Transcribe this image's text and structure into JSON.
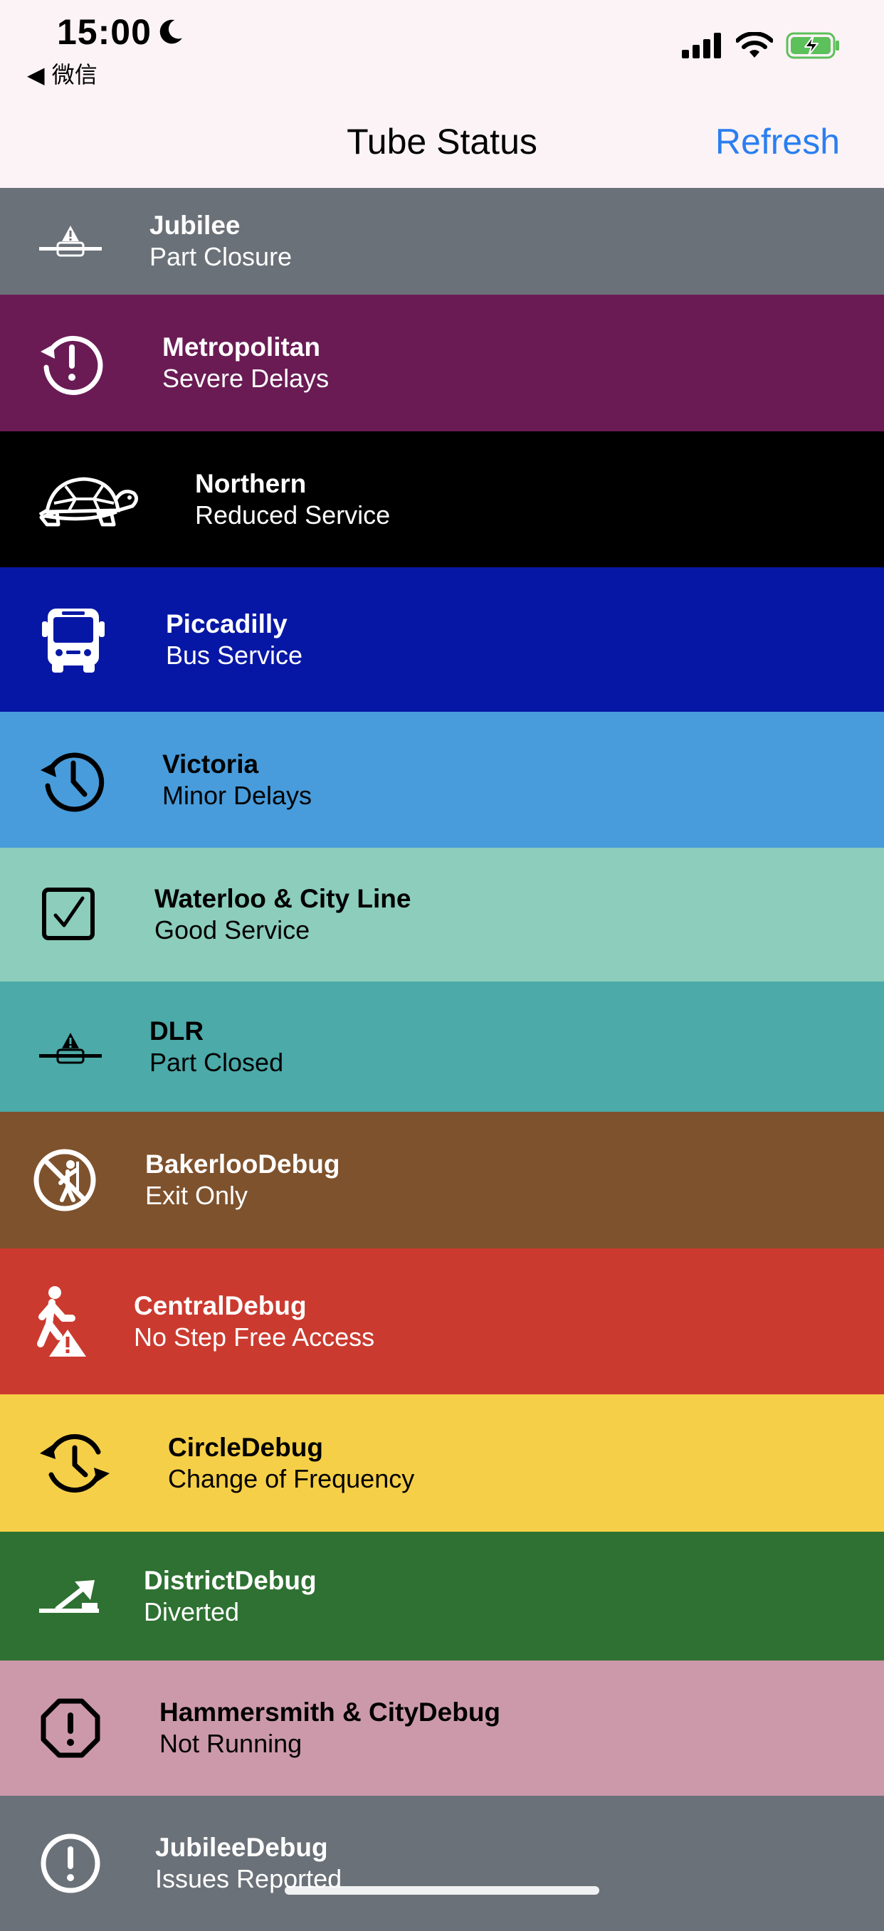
{
  "status_bar": {
    "time": "15:00",
    "back_app": "◀ 微信"
  },
  "nav": {
    "title": "Tube Status",
    "refresh_label": "Refresh"
  },
  "lines": [
    {
      "name": "Jubilee",
      "status": "Part Closure",
      "bg": "#6b7178",
      "fg": "#ffffff",
      "icon": "part-closure-icon"
    },
    {
      "name": "Metropolitan",
      "status": "Severe Delays",
      "bg": "#6a1b54",
      "fg": "#ffffff",
      "icon": "severe-delays-icon"
    },
    {
      "name": "Northern",
      "status": "Reduced Service",
      "bg": "#000000",
      "fg": "#ffffff",
      "icon": "turtle-icon"
    },
    {
      "name": "Piccadilly",
      "status": "Bus Service",
      "bg": "#0717a5",
      "fg": "#ffffff",
      "icon": "bus-icon"
    },
    {
      "name": "Victoria",
      "status": "Minor Delays",
      "bg": "#489cdb",
      "fg": "#000000",
      "icon": "clock-history-icon"
    },
    {
      "name": "Waterloo & City Line",
      "status": "Good Service",
      "bg": "#8ccdbb",
      "fg": "#000000",
      "icon": "checkbox-icon"
    },
    {
      "name": "DLR",
      "status": "Part Closed",
      "bg": "#4caaa9",
      "fg": "#000000",
      "icon": "part-closed-icon"
    },
    {
      "name": "BakerlooDebug",
      "status": "Exit Only",
      "bg": "#7e522d",
      "fg": "#ffffff",
      "icon": "no-entry-person-icon"
    },
    {
      "name": "CentralDebug",
      "status": "No Step Free Access",
      "bg": "#cb3a2f",
      "fg": "#ffffff",
      "icon": "walking-warning-icon"
    },
    {
      "name": "CircleDebug",
      "status": "Change of Frequency",
      "bg": "#f5cf47",
      "fg": "#000000",
      "icon": "clock-cycle-icon"
    },
    {
      "name": "DistrictDebug",
      "status": "Diverted",
      "bg": "#2e7132",
      "fg": "#ffffff",
      "icon": "diverted-icon"
    },
    {
      "name": "Hammersmith & CityDebug",
      "status": "Not Running",
      "bg": "#cc99ab",
      "fg": "#000000",
      "icon": "octagon-exclamation-icon"
    },
    {
      "name": "JubileeDebug",
      "status": "Issues Reported",
      "bg": "#6b7178",
      "fg": "#ffffff",
      "icon": "circle-exclamation-icon"
    }
  ]
}
